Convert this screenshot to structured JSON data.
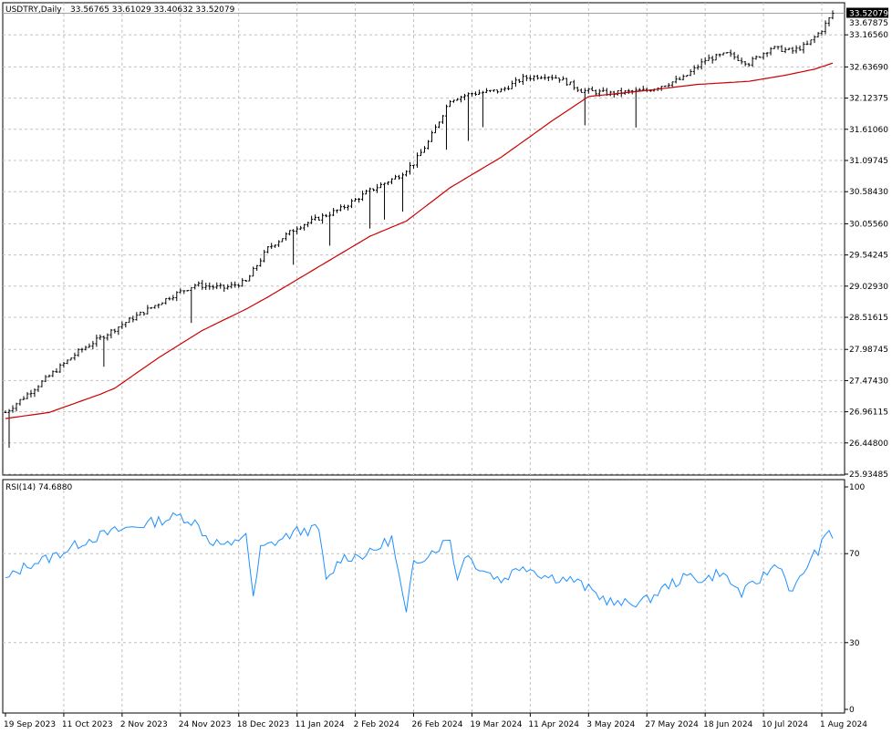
{
  "header": {
    "symbol_label": "USDTRY,Daily",
    "ohlc_text": "33.56765 33.61029 33.40632 33.52079"
  },
  "indicator": {
    "label": "RSI(14) 74.6880"
  },
  "colors": {
    "price_bars": "#000000",
    "moving_average": "#cc0000",
    "rsi_line": "#1e90ff",
    "grid": "#c0c0c0",
    "bid_line": "#a0a0a0"
  },
  "chart_data": {
    "type": "line",
    "title": "USDTRY,Daily",
    "price_axis": {
      "ticks": [
        25.93485,
        26.448,
        26.96115,
        27.4743,
        27.98745,
        28.51615,
        29.0293,
        29.54245,
        30.0556,
        30.5843,
        31.09745,
        31.6106,
        32.12375,
        32.6369,
        33.1656
      ],
      "tick_labels": [
        "25.93485",
        "26.44800",
        "26.96115",
        "27.47430",
        "27.98745",
        "28.51615",
        "29.02930",
        "29.54245",
        "30.05560",
        "30.58430",
        "31.09745",
        "31.61060",
        "32.12375",
        "32.63690",
        "33.16560"
      ],
      "top_label": "33.67875",
      "ylim": [
        25.93485,
        33.67875
      ],
      "current_price": 33.52079,
      "current_price_label": "33.52079",
      "grid": true
    },
    "rsi_axis": {
      "tick_labels": [
        "100",
        "70",
        "30",
        "0"
      ],
      "ticks": [
        100,
        70,
        30,
        0
      ],
      "ylim": [
        0,
        100
      ],
      "grid": true
    },
    "x_axis": {
      "tick_labels": [
        "19 Sep 2023",
        "11 Oct 2023",
        "2 Nov 2023",
        "24 Nov 2023",
        "18 Dec 2023",
        "11 Jan 2024",
        "2 Feb 2024",
        "26 Feb 2024",
        "19 Mar 2024",
        "11 Apr 2024",
        "3 May 2024",
        "27 May 2024",
        "18 Jun 2024",
        "10 Jul 2024",
        "1 Aug 2024"
      ],
      "tick_bar_index": [
        0,
        16,
        32,
        48,
        64,
        80,
        96,
        112,
        128,
        144,
        160,
        176,
        192,
        208,
        224
      ]
    },
    "bar_count": 228,
    "close_keypoints": [
      [
        0,
        26.95
      ],
      [
        6,
        27.25
      ],
      [
        20,
        27.95
      ],
      [
        32,
        28.4
      ],
      [
        45,
        28.85
      ],
      [
        52,
        29.05
      ],
      [
        60,
        29.0
      ],
      [
        66,
        29.1
      ],
      [
        72,
        29.65
      ],
      [
        80,
        30.0
      ],
      [
        92,
        30.3
      ],
      [
        100,
        30.6
      ],
      [
        108,
        30.85
      ],
      [
        112,
        31.05
      ],
      [
        116,
        31.4
      ],
      [
        122,
        32.1
      ],
      [
        128,
        32.2
      ],
      [
        136,
        32.25
      ],
      [
        142,
        32.45
      ],
      [
        148,
        32.5
      ],
      [
        152,
        32.45
      ],
      [
        158,
        32.25
      ],
      [
        166,
        32.2
      ],
      [
        176,
        32.25
      ],
      [
        186,
        32.45
      ],
      [
        192,
        32.75
      ],
      [
        198,
        32.85
      ],
      [
        204,
        32.7
      ],
      [
        210,
        32.95
      ],
      [
        216,
        32.9
      ],
      [
        220,
        33.0
      ],
      [
        224,
        33.25
      ],
      [
        227,
        33.52
      ]
    ],
    "moving_average_keypoints": [
      [
        0,
        26.85
      ],
      [
        12,
        26.95
      ],
      [
        26,
        27.25
      ],
      [
        30,
        27.35
      ],
      [
        42,
        27.85
      ],
      [
        54,
        28.3
      ],
      [
        66,
        28.65
      ],
      [
        72,
        28.85
      ],
      [
        86,
        29.35
      ],
      [
        100,
        29.85
      ],
      [
        110,
        30.1
      ],
      [
        122,
        30.65
      ],
      [
        136,
        31.15
      ],
      [
        150,
        31.75
      ],
      [
        160,
        32.15
      ],
      [
        176,
        32.25
      ],
      [
        190,
        32.35
      ],
      [
        204,
        32.4
      ],
      [
        214,
        32.5
      ],
      [
        222,
        32.6
      ],
      [
        227,
        32.7
      ]
    ],
    "rsi_keypoints": [
      [
        0,
        58
      ],
      [
        6,
        65
      ],
      [
        12,
        68
      ],
      [
        16,
        71
      ],
      [
        22,
        76
      ],
      [
        30,
        80
      ],
      [
        40,
        84
      ],
      [
        48,
        87
      ],
      [
        52,
        84
      ],
      [
        56,
        76
      ],
      [
        62,
        73
      ],
      [
        66,
        80
      ],
      [
        68,
        49
      ],
      [
        70,
        72
      ],
      [
        80,
        80
      ],
      [
        86,
        81
      ],
      [
        88,
        57
      ],
      [
        92,
        68
      ],
      [
        100,
        70
      ],
      [
        106,
        77
      ],
      [
        110,
        42
      ],
      [
        112,
        66
      ],
      [
        118,
        72
      ],
      [
        122,
        77
      ],
      [
        124,
        58
      ],
      [
        126,
        70
      ],
      [
        130,
        64
      ],
      [
        136,
        58
      ],
      [
        142,
        65
      ],
      [
        148,
        60
      ],
      [
        156,
        58
      ],
      [
        164,
        50
      ],
      [
        168,
        47
      ],
      [
        176,
        49
      ],
      [
        182,
        56
      ],
      [
        188,
        60
      ],
      [
        192,
        58
      ],
      [
        196,
        62
      ],
      [
        202,
        52
      ],
      [
        206,
        57
      ],
      [
        212,
        66
      ],
      [
        216,
        52
      ],
      [
        220,
        65
      ],
      [
        224,
        74
      ],
      [
        226,
        80
      ],
      [
        227,
        78
      ]
    ]
  }
}
